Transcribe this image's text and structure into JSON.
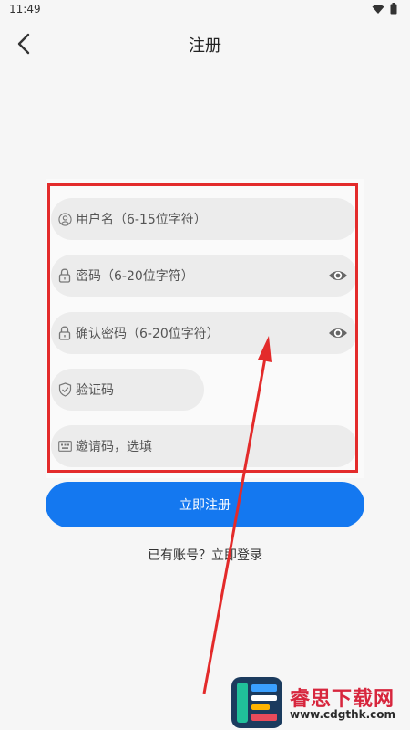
{
  "status_bar": {
    "time": "11:49"
  },
  "header": {
    "title": "注册"
  },
  "form": {
    "username_placeholder": "用户名（6-15位字符）",
    "password_placeholder": "密码（6-20位字符）",
    "confirm_placeholder": "确认密码（6-20位字符）",
    "captcha_placeholder": "验证码",
    "invite_placeholder": "邀请码，选填"
  },
  "actions": {
    "register_label": "立即注册",
    "login_link": "已有账号？立即登录"
  },
  "watermark": {
    "brand": "睿思下载网",
    "url": "www.cdgthk.com"
  },
  "colors": {
    "accent": "#1478f0",
    "annotation": "#e32b2b",
    "field_bg": "#ececec"
  }
}
